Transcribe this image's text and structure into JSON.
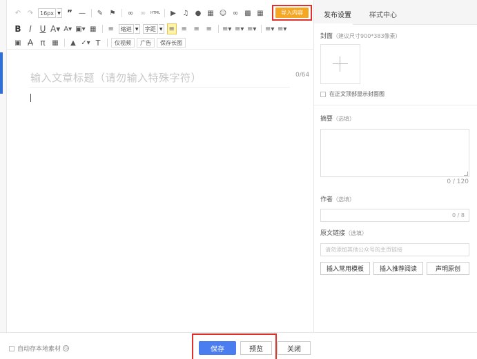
{
  "toolbar": {
    "font_size": "16px",
    "import_label": "导入内容",
    "indent_label": "缩进",
    "spacing_label": "字距",
    "video_only_label": "仅视频",
    "ad_label": "广告",
    "save_long_image_label": "保存长图"
  },
  "editor": {
    "title_placeholder": "输入文章标题（请勿输入特殊字符）",
    "title_count": "0/64"
  },
  "sidebar": {
    "tabs": [
      {
        "label": "发布设置"
      },
      {
        "label": "样式中心"
      }
    ],
    "cover_label": "封面",
    "cover_hint": "（建议尺寸900*383像素）",
    "show_cover_label": "在正文顶部显示封面图",
    "summary_label": "摘要",
    "summary_optional": "（选填）",
    "summary_count": "0 / 120",
    "author_label": "作者",
    "author_optional": "（选填）",
    "author_count": "0 / 8",
    "source_label": "原文链接",
    "source_optional": "（选填）",
    "source_placeholder": "请勿添加其他公众号的主页链接",
    "insert_template_label": "插入常用模板",
    "insert_recommend_label": "插入推荐阅读",
    "declare_original_label": "声明原创"
  },
  "footer": {
    "auto_save_label": "自动存本地素材",
    "save_label": "保存",
    "preview_label": "预览",
    "close_label": "关闭"
  },
  "colors": {
    "accent": "#4a7df0",
    "import": "#f5a623",
    "highlight": "#e0302a"
  }
}
